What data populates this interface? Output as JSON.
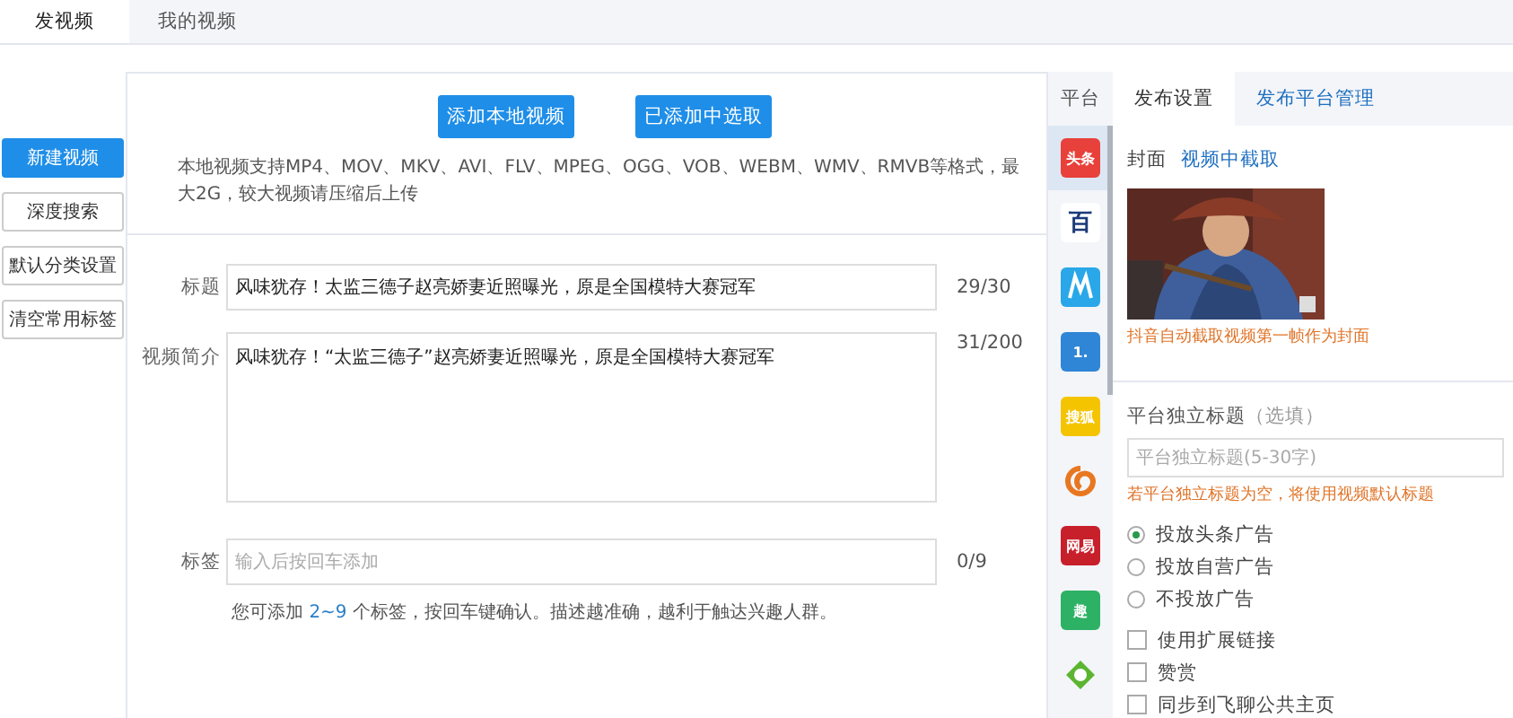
{
  "top_tabs": [
    {
      "label": "发视频",
      "selected": true
    },
    {
      "label": "我的视频",
      "selected": false
    }
  ],
  "sidebar": [
    {
      "label": "新建视频",
      "selected": true
    },
    {
      "label": "深度搜索",
      "selected": false
    },
    {
      "label": "默认分类设置",
      "selected": false
    },
    {
      "label": "清空常用标签",
      "selected": false
    }
  ],
  "upload_buttons": [
    "添加本地视频",
    "已添加中选取"
  ],
  "upload_note": "本地视频支持MP4、MOV、MKV、AVI、FLV、MPEG、OGG、VOB、WEBM、WMV、RMVB等格式，最大2G，较大视频请压缩后上传",
  "fields": [
    {
      "kind": "input",
      "label": "标题",
      "value": "风味犹存！太监三德子赵亮娇妻近照曝光，原是全国模特大赛冠军",
      "count": "29/30"
    },
    {
      "kind": "textarea",
      "label": "视频简介",
      "value": "风味犹存！“太监三德子”赵亮娇妻近照曝光，原是全国模特大赛冠军",
      "count": "31/200"
    },
    {
      "kind": "input",
      "label": "标签",
      "placeholder": "输入后按回车添加",
      "count": "0/9"
    }
  ],
  "tag_hint": "您可添加 **2~9** 个标签，按回车键确认。描述越准确，越利于触达兴趣人群。",
  "platform_header": "平台",
  "settings_tabs": [
    {
      "label": "发布设置",
      "selected": true
    },
    {
      "label": "发布平台管理",
      "selected": false
    }
  ],
  "platforms": [
    {
      "kind": "text",
      "label": "头条",
      "color": "#e8403a",
      "selected": true
    },
    {
      "kind": "text",
      "label": "百",
      "color": "#ffffff",
      "selected": false
    },
    {
      "kind": "m",
      "color": "#2aa7e8",
      "selected": false
    },
    {
      "kind": "text",
      "label": "1.",
      "color": "#2f86d6",
      "selected": false
    },
    {
      "kind": "text",
      "label": "搜狐",
      "color": "#f5c400",
      "selected": false
    },
    {
      "kind": "spiral",
      "color": "#e87722",
      "selected": false
    },
    {
      "kind": "text",
      "label": "网易",
      "color": "#c7202b",
      "selected": false
    },
    {
      "kind": "text",
      "label": "趣",
      "color": "#2db164",
      "selected": false
    },
    {
      "kind": "diamond",
      "color": "#5cb531",
      "selected": false
    }
  ],
  "cover": {
    "label": "封面",
    "link": "视频中截取",
    "note": "抖音自动截取视频第一帧作为封面"
  },
  "platform_title": {
    "label": "平台独立标题",
    "optional": "（选填）",
    "placeholder": "平台独立标题(5-30字)",
    "note": "若平台独立标题为空，将使用视频默认标题"
  },
  "ad_options": [
    {
      "label": "投放头条广告",
      "selected": true
    },
    {
      "label": "投放自营广告",
      "selected": false
    },
    {
      "label": "不投放广告",
      "selected": false
    }
  ],
  "extras": [
    {
      "label": "使用扩展链接",
      "checked": false
    },
    {
      "label": "赞赏",
      "checked": false
    },
    {
      "label": "同步到飞聊公共主页",
      "checked": false
    }
  ]
}
